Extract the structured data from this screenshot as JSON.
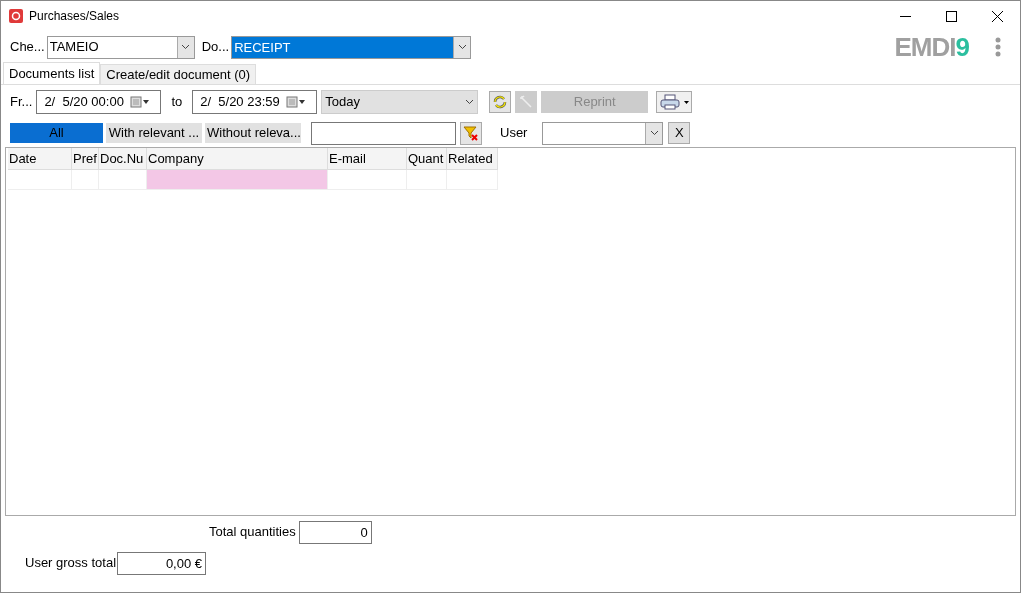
{
  "window": {
    "title": "Purchases/Sales"
  },
  "logo": {
    "text": "EMDI",
    "accent": "9"
  },
  "top_fields": [
    {
      "label": "Che...",
      "value": "TAMEIO",
      "selected": false
    },
    {
      "label": "Do...",
      "value": "RECEIPT",
      "selected": true
    }
  ],
  "tabs": [
    {
      "label": "Documents list",
      "selected": true
    },
    {
      "label": "Create/edit document (0)",
      "selected": false
    }
  ],
  "date_range": {
    "from_label": "Fr...",
    "from": "2/  5/20 00:00",
    "to_label": "to",
    "to": "2/  5/20 23:59",
    "period": "Today"
  },
  "toolbar": {
    "refresh_disabled": false,
    "wand_disabled": true,
    "reprint": {
      "label": "Reprint",
      "disabled": true
    }
  },
  "filters": [
    {
      "label": "All",
      "selected": true
    },
    {
      "label": "With relevant ...",
      "selected": false
    },
    {
      "label": "Without releva...",
      "selected": false
    }
  ],
  "user_filter": {
    "label": "User",
    "clear": "X"
  },
  "table": {
    "columns": [
      {
        "label": "Date",
        "highlighted": false
      },
      {
        "label": "Pref",
        "highlighted": false
      },
      {
        "label": "Doc.Nu",
        "highlighted": false
      },
      {
        "label": "Company",
        "highlighted": true
      },
      {
        "label": "E-mail",
        "highlighted": false
      },
      {
        "label": "Quant",
        "highlighted": false
      },
      {
        "label": "Related",
        "highlighted": false
      }
    ]
  },
  "totals": [
    {
      "label": "Total quantities",
      "value": "0"
    },
    {
      "label": "User gross total",
      "value": "0,00 €"
    }
  ]
}
